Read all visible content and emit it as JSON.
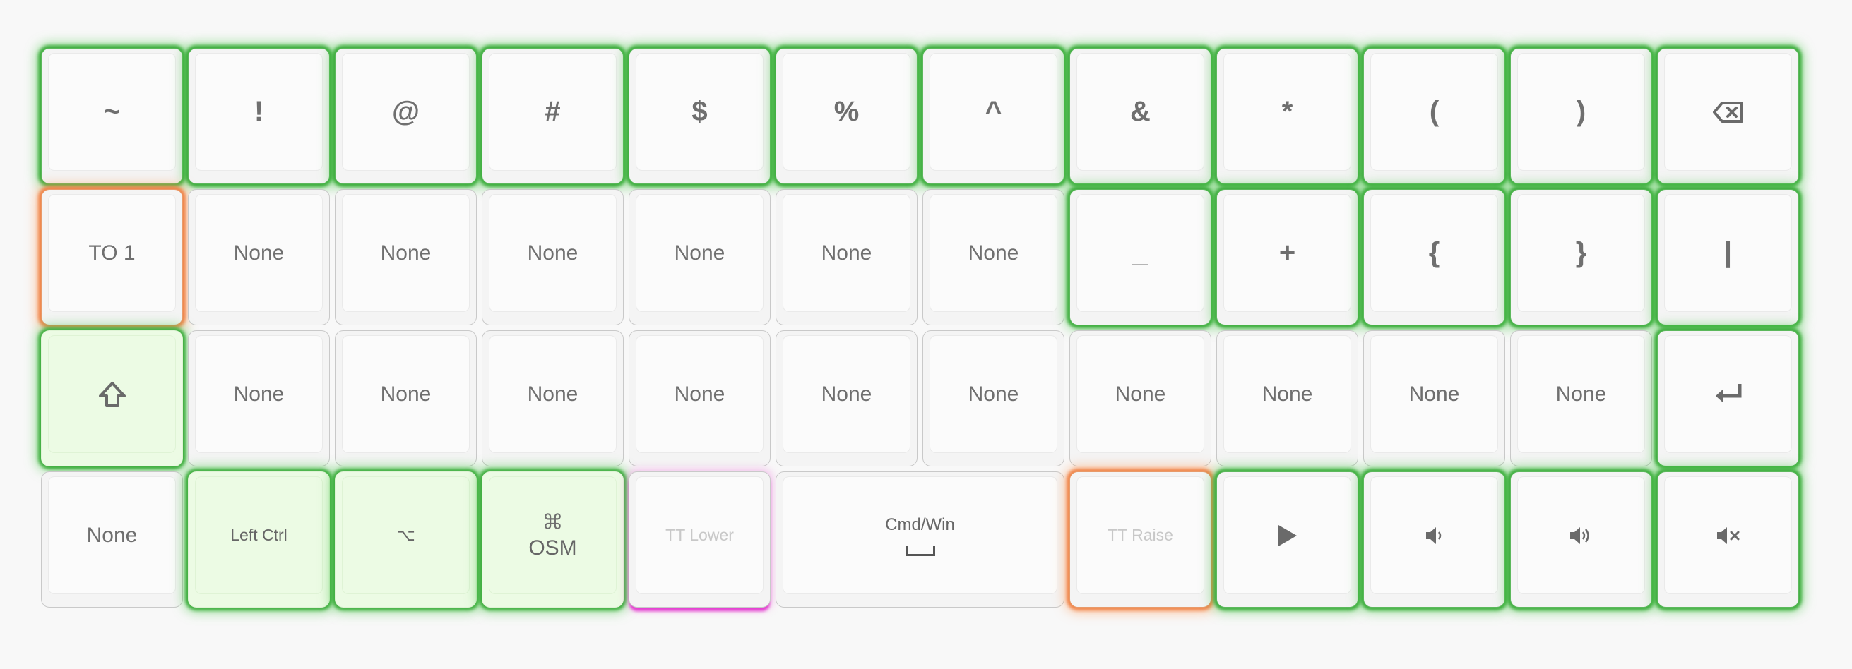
{
  "colors": {
    "glow_green": "#3fae3f",
    "glow_orange": "#f0854a",
    "glow_pink": "#e43bd0",
    "fill_green": "#ecfbe4",
    "key_text": "#6f6f6f"
  },
  "rows": [
    [
      {
        "label": "~"
      },
      {
        "label": "!"
      },
      {
        "label": "@"
      },
      {
        "label": "#"
      },
      {
        "label": "$"
      },
      {
        "label": "%"
      },
      {
        "label": "^"
      },
      {
        "label": "&"
      },
      {
        "label": "*"
      },
      {
        "label": "("
      },
      {
        "label": ")"
      },
      {
        "icon": "backspace-icon"
      }
    ],
    [
      {
        "label": "TO 1"
      },
      {
        "label": "None"
      },
      {
        "label": "None"
      },
      {
        "label": "None"
      },
      {
        "label": "None"
      },
      {
        "label": "None"
      },
      {
        "label": "None"
      },
      {
        "label": "_"
      },
      {
        "label": "+"
      },
      {
        "label": "{"
      },
      {
        "label": "}"
      },
      {
        "label": "|"
      }
    ],
    [
      {
        "icon": "shift-icon"
      },
      {
        "label": "None"
      },
      {
        "label": "None"
      },
      {
        "label": "None"
      },
      {
        "label": "None"
      },
      {
        "label": "None"
      },
      {
        "label": "None"
      },
      {
        "label": "None"
      },
      {
        "label": "None"
      },
      {
        "label": "None"
      },
      {
        "label": "None"
      },
      {
        "icon": "enter-icon"
      }
    ],
    [
      {
        "label": "None"
      },
      {
        "label": "Left Ctrl"
      },
      {
        "label": "⌥"
      },
      {
        "top_label": "⌘",
        "label": "OSM"
      },
      {
        "label": "TT Lower"
      },
      {
        "label": "Cmd/Win",
        "icon": "space-icon"
      },
      {
        "label": "TT Raise"
      },
      {
        "icon": "play-icon"
      },
      {
        "icon": "volume-down-icon"
      },
      {
        "icon": "volume-up-icon"
      },
      {
        "icon": "mute-icon"
      }
    ]
  ]
}
